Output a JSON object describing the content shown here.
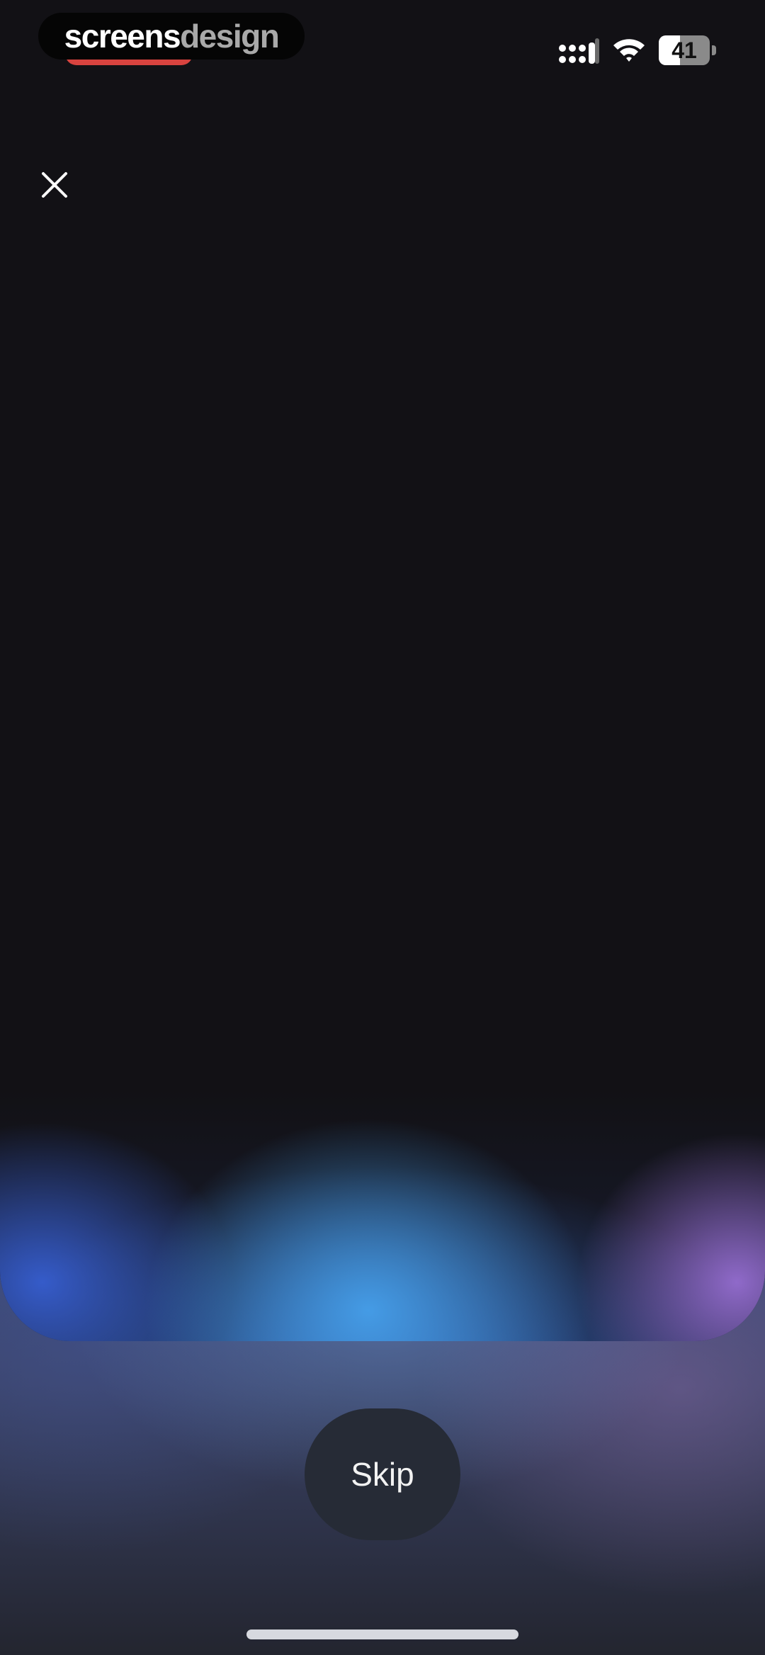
{
  "status_bar": {
    "brand": {
      "part1": "screens",
      "part2": "design"
    },
    "battery_level": "41",
    "battery_fraction": 0.41,
    "icons": [
      "signal-icon",
      "wifi-icon",
      "battery-icon"
    ]
  },
  "header": {
    "close_icon": "close-icon"
  },
  "footer": {
    "skip_label": "Skip"
  },
  "colors": {
    "background": "#121115",
    "glow_blue": "#46a0eb",
    "glow_purple": "#966ed2",
    "skip_button": "#262b36",
    "brand_accent": "#d8433f"
  }
}
